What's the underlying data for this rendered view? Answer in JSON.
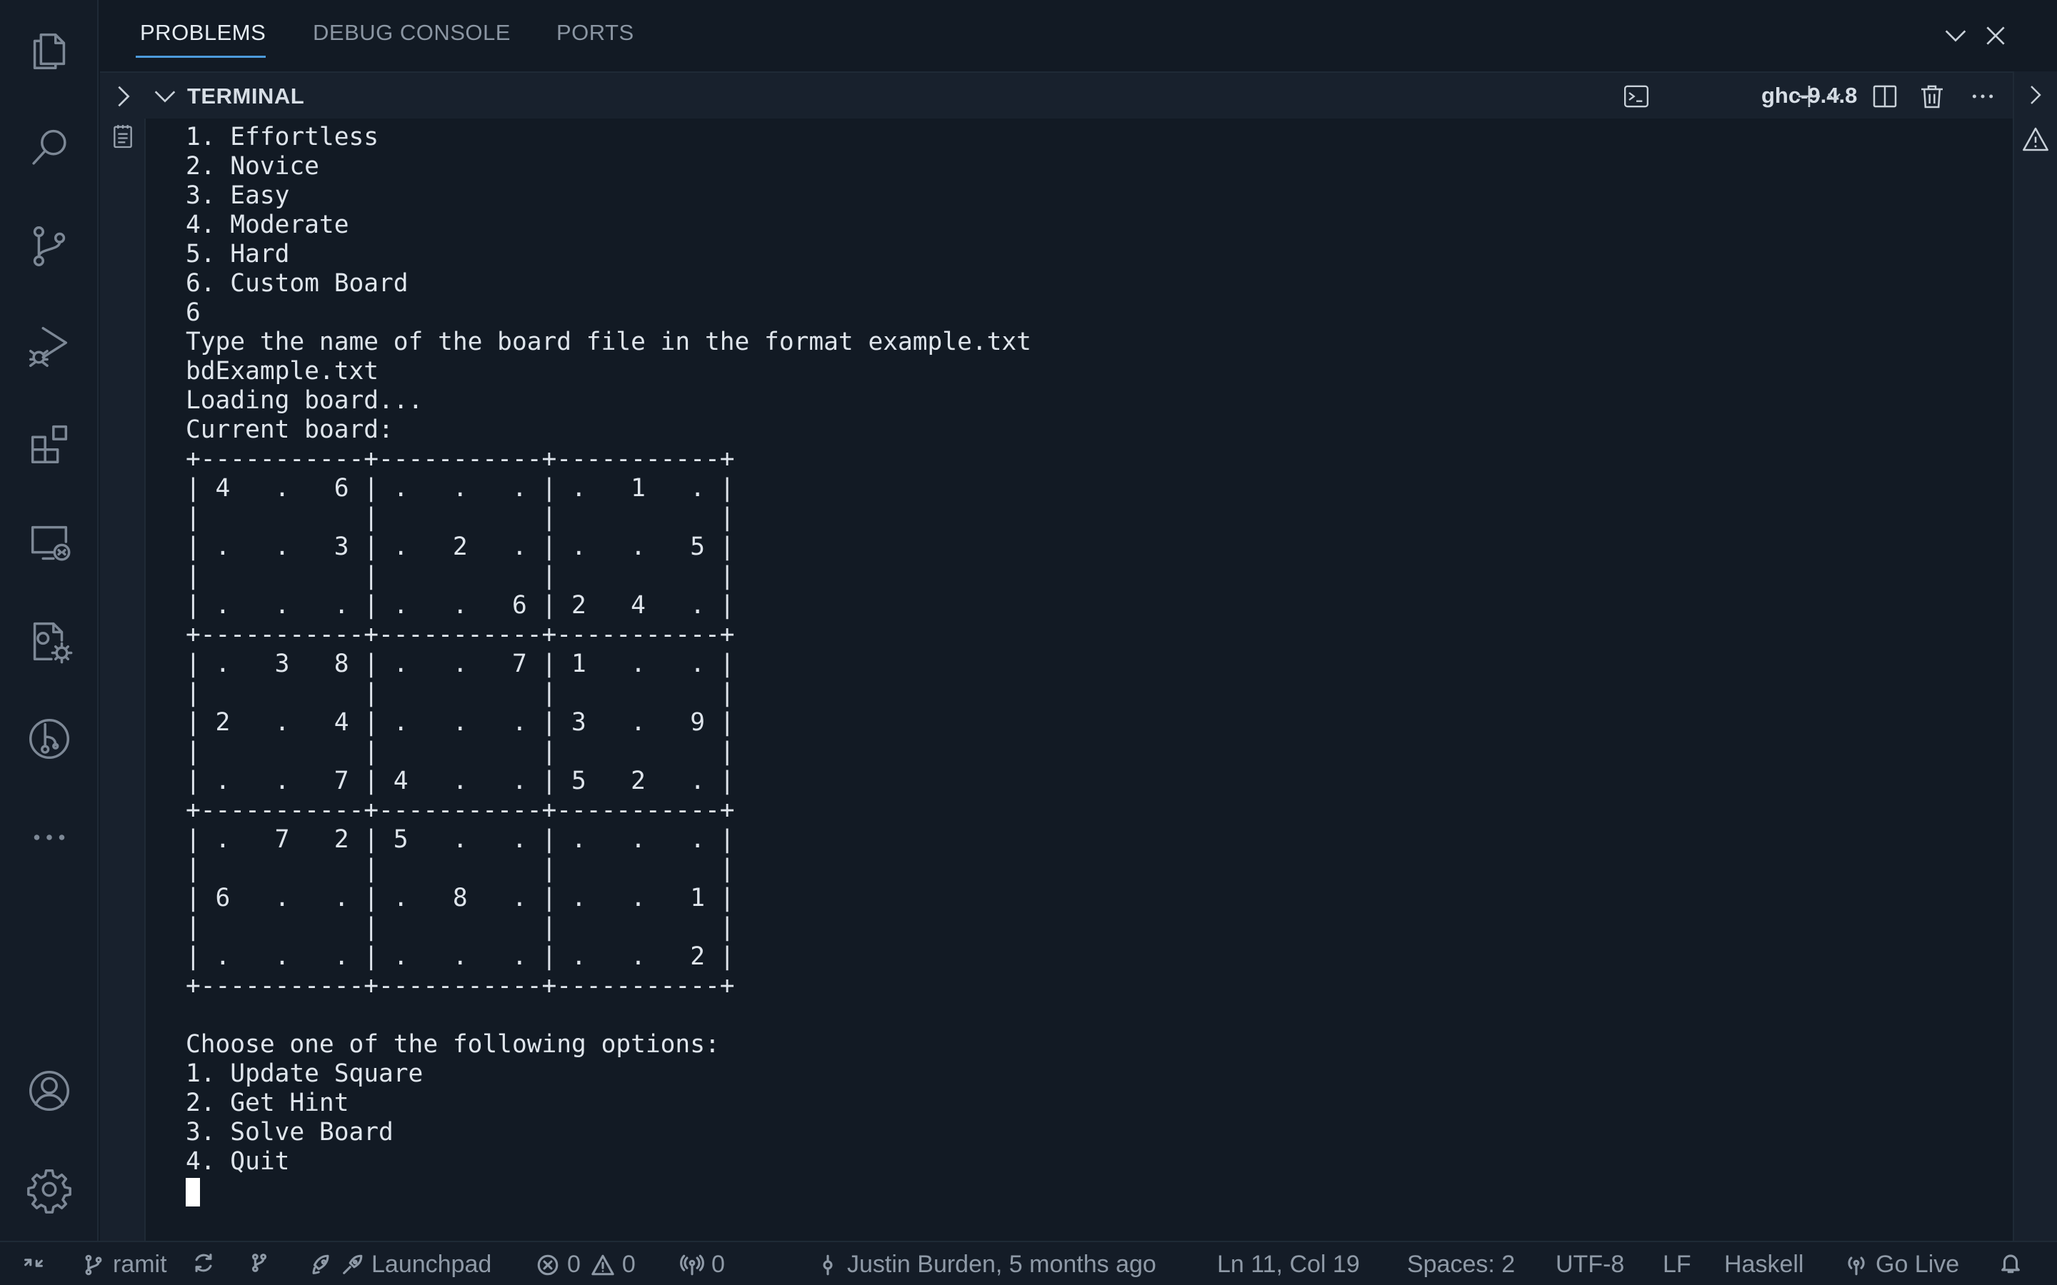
{
  "activity_bar": {
    "items": [
      {
        "name": "explorer",
        "icon": "files-icon"
      },
      {
        "name": "search",
        "icon": "search-icon"
      },
      {
        "name": "source-control",
        "icon": "source-control-icon"
      },
      {
        "name": "run-and-debug",
        "icon": "run-debug-icon"
      },
      {
        "name": "extensions",
        "icon": "extensions-icon"
      },
      {
        "name": "remote-explorer",
        "icon": "remote-explorer-icon"
      },
      {
        "name": "test-gear",
        "icon": "flask-gear-icon"
      },
      {
        "name": "git-graph",
        "icon": "git-graph-icon"
      },
      {
        "name": "more",
        "icon": "ellipsis-icon"
      }
    ],
    "bottom": [
      {
        "name": "accounts",
        "icon": "account-icon"
      },
      {
        "name": "manage",
        "icon": "gear-icon"
      }
    ]
  },
  "panel": {
    "tabs": [
      "PROBLEMS",
      "DEBUG CONSOLE",
      "PORTS"
    ],
    "active_tab": "PROBLEMS"
  },
  "terminal_section": {
    "title": "TERMINAL",
    "profile": "ghc-9.4.8"
  },
  "terminal": {
    "lines": [
      "1. Effortless",
      "2. Novice",
      "3. Easy",
      "4. Moderate",
      "5. Hard",
      "6. Custom Board",
      "6",
      "Type the name of the board file in the format example.txt",
      "bdExample.txt",
      "Loading board...",
      "Current board:",
      "+-----------+-----------+-----------+",
      "| 4   .   6 | .   .   . | .   1   . |",
      "|           |           |           |",
      "| .   .   3 | .   2   . | .   .   5 |",
      "|           |           |           |",
      "| .   .   . | .   .   6 | 2   4   . |",
      "+-----------+-----------+-----------+",
      "| .   3   8 | .   .   7 | 1   .   . |",
      "|           |           |           |",
      "| 2   .   4 | .   .   . | 3   .   9 |",
      "|           |           |           |",
      "| .   .   7 | 4   .   . | 5   2   . |",
      "+-----------+-----------+-----------+",
      "| .   7   2 | 5   .   . | .   .   . |",
      "|           |           |           |",
      "| 6   .   . | .   8   . | .   .   1 |",
      "|           |           |           |",
      "| .   .   . | .   .   . | .   .   2 |",
      "+-----------+-----------+-----------+",
      "",
      "Choose one of the following options:",
      "1. Update Square",
      "2. Get Hint",
      "3. Solve Board",
      "4. Quit",
      ""
    ]
  },
  "status_bar": {
    "branch": "ramit",
    "launchpad": "Launchpad",
    "errors": "0",
    "warnings": "0",
    "ports": "0",
    "blame": "Justin Burden, 5 months ago",
    "cursor_pos": "Ln 11, Col 19",
    "spaces": "Spaces: 2",
    "encoding": "UTF-8",
    "eol": "LF",
    "language": "Haskell",
    "go_live": "Go Live"
  },
  "colors": {
    "background": "#121a24",
    "accent": "#4d9bdc",
    "text": "#dfe5ec"
  }
}
